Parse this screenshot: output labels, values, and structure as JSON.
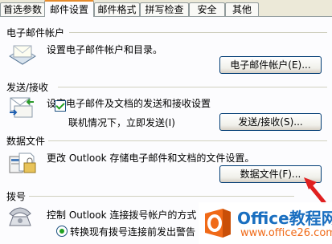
{
  "tabs": [
    "首选参数",
    "邮件设置",
    "邮件格式",
    "拼写检查",
    "安全",
    "其他"
  ],
  "sections": {
    "email": {
      "title": "电子邮件帐户",
      "desc": "设置电子邮件帐户和目录。",
      "button": "电子邮件帐户(E)..."
    },
    "sendrecv": {
      "title": "发送/接收",
      "desc": "设定电子邮件及文档的发送和接收设置",
      "checkbox": "联机情况下，立即发送(I)",
      "button": "发送/接收(S)..."
    },
    "datafiles": {
      "title": "数据文件",
      "desc": "更改 Outlook 存储电子邮件和文档的文件设置。",
      "button": "数据文件(F)..."
    },
    "dialup": {
      "title": "拨号",
      "desc": "控制 Outlook 连接拨号帐户的方式",
      "radio": "转换现有拨号连接前发出警告"
    }
  },
  "watermark": {
    "brand_top": "Office教程网",
    "brand_bottom": "www.office26.com"
  },
  "colors": {
    "tab_active_accent": "#e68b2c",
    "arrow": "#e02020",
    "logo_orange": "#f06a18",
    "logo_blue": "#1a6fc0"
  }
}
